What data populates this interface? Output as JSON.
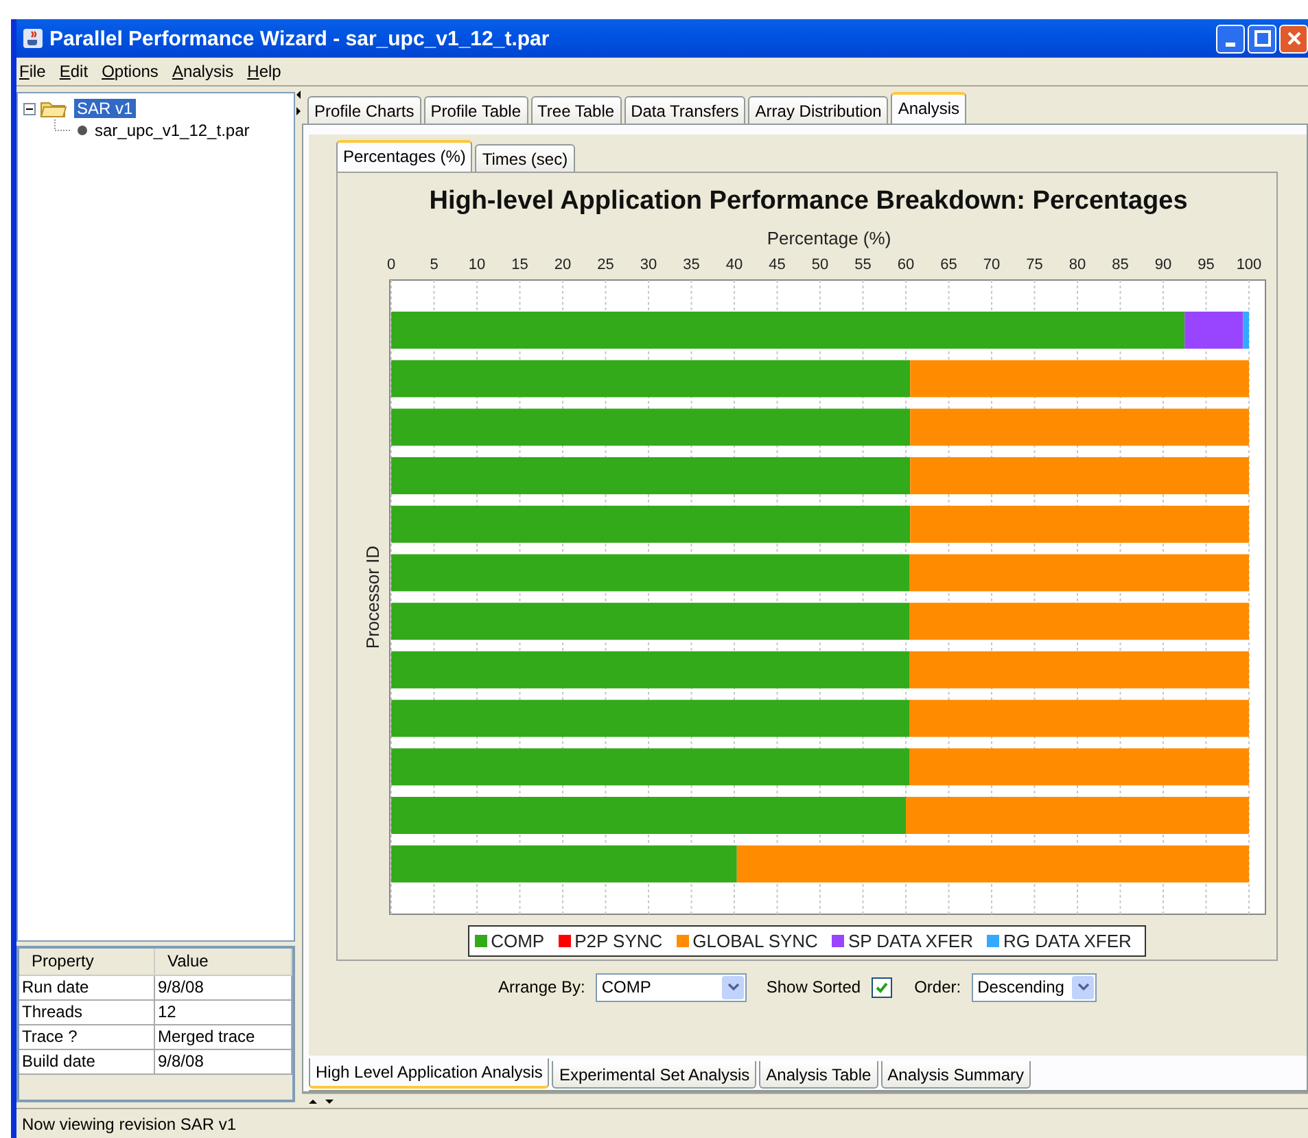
{
  "window": {
    "title": "Parallel Performance Wizard - sar_upc_v1_12_t.par"
  },
  "menu": [
    "File",
    "Edit",
    "Options",
    "Analysis",
    "Help"
  ],
  "tree": [
    {
      "label": "SAR v1",
      "expanded": true,
      "selected": true,
      "children": [
        {
          "label": "sar_upc_v1_12_t.par",
          "selected": false
        }
      ]
    }
  ],
  "properties": {
    "columns": [
      "Property",
      "Value"
    ],
    "rows": [
      [
        "Run date",
        "9/8/08"
      ],
      [
        "Threads",
        "12"
      ],
      [
        "Trace ?",
        "Merged trace"
      ],
      [
        "Build date",
        "9/8/08"
      ]
    ]
  },
  "main_tabs": [
    {
      "label": "Profile Charts",
      "selected": false
    },
    {
      "label": "Profile Table",
      "selected": false
    },
    {
      "label": "Tree Table",
      "selected": false
    },
    {
      "label": "Data Transfers",
      "selected": false
    },
    {
      "label": "Array Distribution",
      "selected": false
    },
    {
      "label": "Analysis",
      "selected": true
    }
  ],
  "view_tabs": [
    {
      "label": "Percentages (%)",
      "selected": true
    },
    {
      "label": "Times (sec)",
      "selected": false
    }
  ],
  "chart": {
    "chart_data": {
      "type": "bar",
      "orientation": "horizontal",
      "stacked": true,
      "title": "High-level Application Performance Breakdown: Percentages",
      "xlabel": "Percentage (%)",
      "ylabel": "Processor ID",
      "xlim": [
        0,
        100
      ],
      "grid": true,
      "legend": true,
      "xticks": [
        0,
        5,
        10,
        15,
        20,
        25,
        30,
        35,
        40,
        45,
        50,
        55,
        60,
        65,
        70,
        75,
        80,
        85,
        90,
        95,
        100
      ],
      "series": [
        {
          "name": "COMP",
          "color": "#33aa1a",
          "values": [
            92.5,
            60.5,
            60.5,
            60.5,
            60.5,
            60.4,
            60.4,
            60.4,
            60.4,
            60.4,
            60.0,
            40.3
          ]
        },
        {
          "name": "P2P SYNC",
          "color": "#ff0000",
          "values": [
            0,
            0,
            0,
            0,
            0,
            0,
            0,
            0,
            0,
            0,
            0,
            0
          ]
        },
        {
          "name": "GLOBAL SYNC",
          "color": "#ff8c00",
          "values": [
            0,
            39.5,
            39.5,
            39.5,
            39.5,
            39.6,
            39.6,
            39.6,
            39.6,
            39.6,
            40.0,
            59.7
          ]
        },
        {
          "name": "SP DATA XFER",
          "color": "#9944ff",
          "values": [
            6.8,
            0,
            0,
            0,
            0,
            0,
            0,
            0,
            0,
            0,
            0,
            0
          ]
        },
        {
          "name": "RG DATA XFER",
          "color": "#33aaff",
          "values": [
            0.7,
            0,
            0,
            0,
            0,
            0,
            0,
            0,
            0,
            0,
            0,
            0
          ]
        }
      ]
    }
  },
  "controls": {
    "arrange_by": {
      "label": "Arrange By:",
      "value": "COMP"
    },
    "show_sorted": {
      "label": "Show Sorted",
      "checked": true
    },
    "order": {
      "label": "Order:",
      "value": "Descending"
    }
  },
  "bottom_tabs": [
    {
      "label": "High Level Application Analysis",
      "selected": true
    },
    {
      "label": "Experimental Set Analysis",
      "selected": false
    },
    {
      "label": "Analysis Table",
      "selected": false
    },
    {
      "label": "Analysis Summary",
      "selected": false
    }
  ],
  "status_bar": "Now viewing revision SAR v1"
}
